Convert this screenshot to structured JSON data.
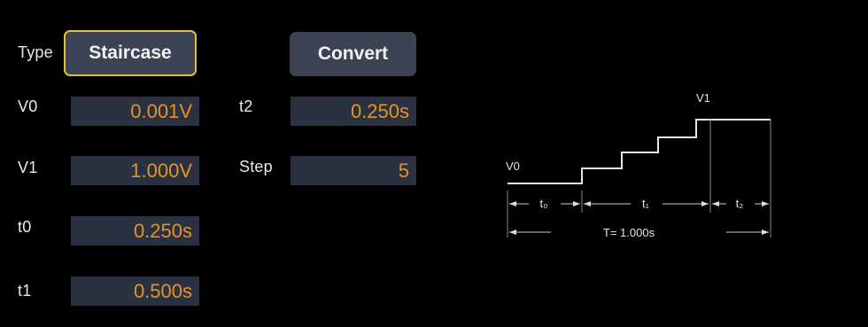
{
  "form": {
    "type_label": "Type",
    "type_value": "Staircase",
    "convert_label": "Convert",
    "v0_label": "V0",
    "v0_value": "0.001V",
    "v1_label": "V1",
    "v1_value": "1.000V",
    "t0_label": "t0",
    "t0_value": "0.250s",
    "t1_label": "t1",
    "t1_value": "0.500s",
    "t2_label": "t2",
    "t2_value": "0.250s",
    "step_label": "Step",
    "step_value": "5"
  },
  "diagram": {
    "v0": "V0",
    "v1": "V1",
    "t0": "t₀",
    "t1": "t₁",
    "t2": "t₂",
    "period": "T= 1.000s"
  },
  "colors": {
    "background": "#000000",
    "field_bg": "#2a3140",
    "value_text": "#e39425",
    "button_bg": "#3c4354",
    "selected_border": "#e1c032"
  }
}
